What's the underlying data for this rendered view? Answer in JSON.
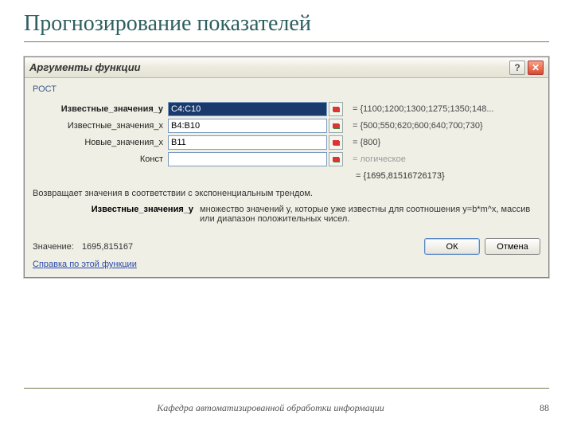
{
  "slide": {
    "title": "Прогнозирование  показателей",
    "footer_text": "Кафедра автоматизированной обработки информации",
    "page_number": "88"
  },
  "dialog": {
    "title": "Аргументы функции",
    "function_name": "РОСТ",
    "args": [
      {
        "label": "Известные_значения_y",
        "bold": true,
        "value": "C4:C10",
        "selected": true,
        "result": "= {1100;1200;1300;1275;1350;148..."
      },
      {
        "label": "Известные_значения_x",
        "bold": false,
        "value": "B4:B10",
        "selected": false,
        "result": "= {500;550;620;600;640;700;730}"
      },
      {
        "label": "Новые_значения_x",
        "bold": false,
        "value": "B11",
        "selected": false,
        "result": "= {800}"
      },
      {
        "label": "Конст",
        "bold": false,
        "value": "",
        "selected": false,
        "result": "= логическое",
        "grey": true
      }
    ],
    "overall_result": "= {1695,81516726173}",
    "description": "Возвращает значения в соответствии с экспоненциальным трендом.",
    "param_help": {
      "name": "Известные_значения_y",
      "text": "множество значений y, которые уже известны для соотношения y=b*m^x, массив или диапазон положительных чисел."
    },
    "value_label": "Значение:",
    "value_number": "1695,815167",
    "help_link": "Справка по этой функции",
    "ok": "ОК",
    "cancel": "Отмена"
  }
}
